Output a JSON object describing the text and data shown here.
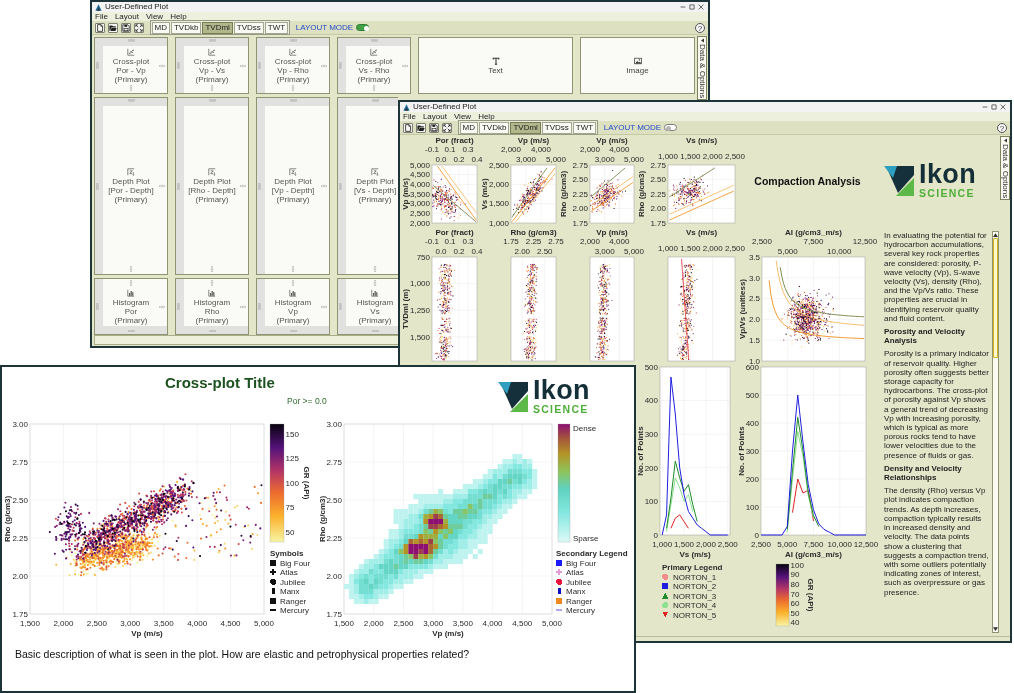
{
  "back_window": {
    "title": "User-Defined Plot",
    "menu": [
      "File",
      "Layout",
      "View",
      "Help"
    ],
    "depth_tabs": [
      {
        "label": "MD",
        "selected": false
      },
      {
        "label": "TVDkb",
        "selected": false
      },
      {
        "label": "TVDml",
        "selected": true
      },
      {
        "label": "TVDss",
        "selected": false
      },
      {
        "label": "TWT",
        "selected": false
      }
    ],
    "layout_mode": {
      "label": "LAYOUT MODE",
      "on": true
    },
    "help": "?",
    "side_tab": "Data & Options",
    "layout_rows": [
      [
        {
          "kind": "crossplot",
          "title": "Cross-plot",
          "subtitle": "Por - Vp",
          "note": "(Primary)"
        },
        {
          "kind": "crossplot",
          "title": "Cross-plot",
          "subtitle": "Vp - Vs",
          "note": "(Primary)"
        },
        {
          "kind": "crossplot",
          "title": "Cross-plot",
          "subtitle": "Vp - Rho",
          "note": "(Primary)"
        },
        {
          "kind": "crossplot",
          "title": "Cross-plot",
          "subtitle": "Vs - Rho",
          "note": "(Primary)"
        },
        {
          "kind": "text",
          "title": "Text"
        },
        {
          "kind": "image",
          "title": "Image"
        }
      ],
      [
        {
          "kind": "depth",
          "title": "Depth Plot",
          "subtitle": "[Por - Depth]",
          "note": "(Primary)"
        },
        {
          "kind": "depth",
          "title": "Depth Plot",
          "subtitle": "[Rho - Depth]",
          "note": "(Primary)"
        },
        {
          "kind": "depth",
          "title": "Depth Plot",
          "subtitle": "[Vp - Depth]",
          "note": "(Primary)"
        },
        {
          "kind": "depth",
          "title": "Depth Plot",
          "subtitle": "[Vs - Depth]",
          "note": "(Primary)"
        }
      ],
      [
        {
          "kind": "histogram",
          "title": "Histogram",
          "subtitle": "Por",
          "note": "(Primary)"
        },
        {
          "kind": "histogram",
          "title": "Histogram",
          "subtitle": "Rho",
          "note": "(Primary)"
        },
        {
          "kind": "histogram",
          "title": "Histogram",
          "subtitle": "Vp",
          "note": "(Primary)"
        },
        {
          "kind": "histogram",
          "title": "Histogram",
          "subtitle": "Vs",
          "note": "(Primary)"
        }
      ]
    ]
  },
  "middle_window": {
    "title": "User-Defined Plot",
    "menu": [
      "File",
      "Layout",
      "View",
      "Help"
    ],
    "depth_tabs": [
      {
        "label": "MD",
        "selected": false
      },
      {
        "label": "TVDkb",
        "selected": false
      },
      {
        "label": "TVDml",
        "selected": true
      },
      {
        "label": "TVDss",
        "selected": false
      },
      {
        "label": "TWT",
        "selected": false
      }
    ],
    "layout_mode": {
      "label": "LAYOUT MODE",
      "on": false
    },
    "help": "?",
    "side_tab": "Data & Options",
    "crossplots": [
      {
        "x_title": "Por (fract)",
        "x_ticks": [
          "-0.1",
          "0.0",
          "0.1",
          "0.2",
          "0.3",
          "0.4"
        ],
        "y_title": "Vp (m/s)",
        "y_ticks": [
          "5,000",
          "4,500",
          "4,000",
          "3,500",
          "3,000",
          "2,500",
          "2,000"
        ]
      },
      {
        "x_title": "Vp (m/s)",
        "x_ticks": [
          "2,000",
          "3,000",
          "4,000",
          "5,000"
        ],
        "y_title": "Vs (m/s)",
        "y_ticks": [
          "2,500",
          "2,000",
          "1,500",
          "1,000"
        ]
      },
      {
        "x_title": "Vp (m/s)",
        "x_ticks": [
          "2,000",
          "3,000",
          "4,000",
          "5,000"
        ],
        "y_title": "Rho (g/cm3)",
        "y_ticks": [
          "2.75",
          "2.50",
          "2.25",
          "2.00",
          "1.75"
        ]
      },
      {
        "x_title": "Vs (m/s)",
        "x_ticks": [
          "1,000",
          "1,500",
          "2,000",
          "2,500"
        ],
        "y_title": "Rho (g/cm3)",
        "y_ticks": [
          "2.75",
          "2.50",
          "2.25",
          "2.00",
          "1.75"
        ]
      }
    ],
    "heading": "Compaction Analysis",
    "logo": {
      "word": "Ikon",
      "tagline": "SCIENCE"
    },
    "depth_axis": {
      "title": "TVDml (m)",
      "ticks": [
        "750",
        "1,000",
        "1,250",
        "1,500"
      ]
    },
    "depth_plots": [
      {
        "x_title": "Por (fract)",
        "x_ticks": [
          "-0.1",
          "0.0",
          "0.1",
          "0.2",
          "0.3",
          "0.4"
        ]
      },
      {
        "x_title": "Rho (g/cm3)",
        "x_ticks": [
          "1.75",
          "2.00",
          "2.25",
          "2.50",
          "2.75"
        ]
      },
      {
        "x_title": "Vp (m/s)",
        "x_ticks": [
          "2,000",
          "3,000",
          "4,000",
          "5,000"
        ]
      },
      {
        "x_title": "Vs (m/s)",
        "x_ticks": [
          "1,000",
          "1,500",
          "2,000",
          "2,500"
        ]
      }
    ],
    "ai_plot": {
      "x_title": "AI (g/cm3_m/s)",
      "x_ticks": [
        "2,500",
        "5,000",
        "7,500",
        "10,000",
        "12,500"
      ],
      "y_title": "Vp/Vs (unitless)",
      "y_ticks": [
        "3.5",
        "3.0",
        "2.5",
        "2.0",
        "1.5",
        "1.0"
      ]
    },
    "notes": [
      {
        "kind": "paragraph",
        "text": "In evaluating the potential for hydrocarbon accumulations, several key rock properties are considered: porosity, P-wave velocity (Vp), S-wave velocity (Vs), density (Rho), and the Vp/Vs ratio. These properties are crucial in identifying reservoir quality and fluid content."
      },
      {
        "kind": "heading",
        "text": "Porosity and Velocity Analysis"
      },
      {
        "kind": "paragraph",
        "text": "Porosity is a primary indicator of reservoir quality. Higher porosity often suggests better storage capacity for hydrocarbons. The cross-plot of porosity against Vp shows a general trend of decreasing Vp with increasing porosity, which is typical as more porous rocks tend to have lower velocities due to the presence of fluids or gas."
      },
      {
        "kind": "heading",
        "text": "Density and Velocity Relationships"
      },
      {
        "kind": "paragraph",
        "text": "The density (Rho) versus Vp plot indicates compaction trends. As depth increases, compaction typically results in increased density and velocity. The data points show a clustering that suggests a compaction trend, with some outliers potentially indicating zones of interest, such as overpressure or gas presence."
      }
    ],
    "histograms": [
      {
        "chart_data": {
          "type": "line",
          "xlabel": "Vs (m/s)",
          "ylabel": "No. of Points",
          "grid": true,
          "x": [
            1000,
            1100,
            1200,
            1300,
            1400,
            1500,
            1600,
            1700,
            1800,
            1900,
            2000,
            2100,
            2200,
            2300,
            2400,
            2500
          ],
          "xlim": [
            950,
            2550
          ],
          "ylim": [
            0,
            500
          ],
          "xticks": [
            {
              "value": 1000,
              "label": "1,000"
            },
            {
              "value": 1500,
              "label": "1,500"
            },
            {
              "value": 2000,
              "label": "2,000"
            },
            {
              "value": 2500,
              "label": "2,500"
            }
          ],
          "yticks": [
            500,
            400,
            300,
            200,
            100,
            0
          ],
          "series": [
            {
              "color": "#e02424",
              "values": [
                null,
                null,
                20,
                50,
                60,
                40,
                20,
                null,
                null,
                null,
                null,
                null,
                null,
                null,
                null,
                null
              ]
            },
            {
              "color": "#8fe08f",
              "values": [
                null,
                10,
                90,
                170,
                140,
                100,
                120,
                70,
                null,
                null,
                null,
                null,
                null,
                null,
                null,
                null
              ]
            },
            {
              "color": "#1e8c2a",
              "values": [
                null,
                20,
                110,
                220,
                170,
                130,
                150,
                90,
                40,
                null,
                null,
                null,
                null,
                null,
                null,
                null
              ]
            },
            {
              "color": "#1f1fe0",
              "values": [
                0,
                60,
                470,
                360,
                200,
                120,
                70,
                50,
                30,
                20,
                10,
                0,
                0,
                0,
                0,
                0
              ]
            }
          ]
        }
      },
      {
        "chart_data": {
          "type": "line",
          "xlabel": "AI (g/cm3_m/s)",
          "ylabel": "No. of Points",
          "grid": true,
          "x": [
            2500,
            3000,
            3500,
            4000,
            4500,
            5000,
            5500,
            6000,
            6500,
            7000,
            7500,
            8000,
            8500,
            9000,
            9500,
            10000,
            10500,
            11000,
            11500,
            12000,
            12500
          ],
          "xlim": [
            2500,
            12500
          ],
          "ylim": [
            0,
            600
          ],
          "xticks": [
            {
              "value": 2500,
              "label": "2,500"
            },
            {
              "value": 5000,
              "label": "5,000"
            },
            {
              "value": 7500,
              "label": "7,500"
            },
            {
              "value": 10000,
              "label": "10,000"
            },
            {
              "value": 12500,
              "label": "12,500"
            }
          ],
          "yticks": [
            600,
            500,
            400,
            300,
            200,
            100,
            0
          ],
          "series": [
            {
              "color": "#e02424",
              "values": [
                null,
                null,
                null,
                null,
                null,
                null,
                80,
                200,
                150,
                160,
                50,
                null,
                null,
                null,
                null,
                null,
                null,
                null,
                null,
                null,
                null
              ]
            },
            {
              "color": "#8fe08f",
              "values": [
                null,
                null,
                null,
                null,
                null,
                10,
                200,
                370,
                280,
                140,
                60,
                null,
                null,
                null,
                null,
                null,
                null,
                null,
                null,
                null,
                null
              ]
            },
            {
              "color": "#1e8c2a",
              "values": [
                null,
                null,
                null,
                null,
                null,
                20,
                230,
                420,
                300,
                150,
                70,
                30,
                null,
                null,
                null,
                null,
                null,
                null,
                null,
                null,
                null
              ]
            },
            {
              "color": "#1f1fe0",
              "values": [
                0,
                0,
                0,
                0,
                0,
                30,
                300,
                500,
                330,
                180,
                90,
                40,
                20,
                10,
                0,
                0,
                0,
                0,
                0,
                0,
                0
              ]
            }
          ]
        }
      }
    ],
    "legend": {
      "title": "Primary Legend",
      "items": [
        {
          "label": "NORTON_1",
          "kind": "circle",
          "color": "#f28b8b"
        },
        {
          "label": "NORTON_2",
          "kind": "square",
          "color": "#1f1fe0"
        },
        {
          "label": "NORTON_3",
          "kind": "triangle",
          "color": "#1e8c2a"
        },
        {
          "label": "NORTON_4",
          "kind": "circle",
          "color": "#8fe08f"
        },
        {
          "label": "NORTON_5",
          "kind": "triangle_down",
          "color": "#e02424"
        }
      ]
    },
    "colorbar": {
      "title": "GR (API)",
      "ticks": [
        "100",
        "90",
        "80",
        "70",
        "60",
        "50",
        "40"
      ]
    }
  },
  "front_window": {
    "title": "Cross-plot Title",
    "subtitle": "Por >= 0.0",
    "logo": {
      "word": "Ikon",
      "tagline": "SCIENCE"
    },
    "scatter": {
      "x_title": "Vp (m/s)",
      "x_ticks": [
        "1,500",
        "2,000",
        "2,500",
        "3,000",
        "3,500",
        "4,000",
        "4,500",
        "5,000"
      ],
      "y_title": "Rho (g/cm3)",
      "y_ticks": [
        "3.00",
        "2.75",
        "2.50",
        "2.25",
        "2.00",
        "1.75"
      ]
    },
    "colorbar": {
      "title": "GR (API)",
      "ticks": [
        "150",
        "125",
        "100",
        "75",
        "50"
      ]
    },
    "symbols": {
      "title": "Symbols",
      "items": [
        {
          "label": "Big Four",
          "kind": "square"
        },
        {
          "label": "Atlas",
          "kind": "plus"
        },
        {
          "label": "Jubilee",
          "kind": "circle"
        },
        {
          "label": "Manx",
          "kind": "bar"
        },
        {
          "label": "Ranger",
          "kind": "square"
        },
        {
          "label": "Mercury",
          "kind": "dash"
        }
      ]
    },
    "density": {
      "x_title": "Vp (m/s)",
      "x_ticks": [
        "1,500",
        "2,000",
        "2,500",
        "3,000",
        "3,500",
        "4,000",
        "4,500",
        "5,000"
      ],
      "y_title": "Rho (g/cm3)",
      "y_ticks": [
        "3.00",
        "2.75",
        "2.50",
        "2.25",
        "2.00",
        "1.75"
      ],
      "high_label": "Dense",
      "low_label": "Sparse"
    },
    "secondary_legend": {
      "title": "Secondary Legend",
      "items": [
        {
          "label": "Big Four",
          "kind": "square",
          "color": "#1a1aff"
        },
        {
          "label": "Atlas",
          "kind": "plus",
          "color": "#e59ad8"
        },
        {
          "label": "Jubilee",
          "kind": "circle",
          "color": "#e8143c"
        },
        {
          "label": "Manx",
          "kind": "bar",
          "color": "#1010c0"
        },
        {
          "label": "Ranger",
          "kind": "square",
          "color": "#f08a20"
        },
        {
          "label": "Mercury",
          "kind": "dash",
          "color": "#b0a8e8"
        }
      ]
    },
    "description": "Basic description of what is seen in the plot. How are elastic and petrophysical properties related?"
  }
}
